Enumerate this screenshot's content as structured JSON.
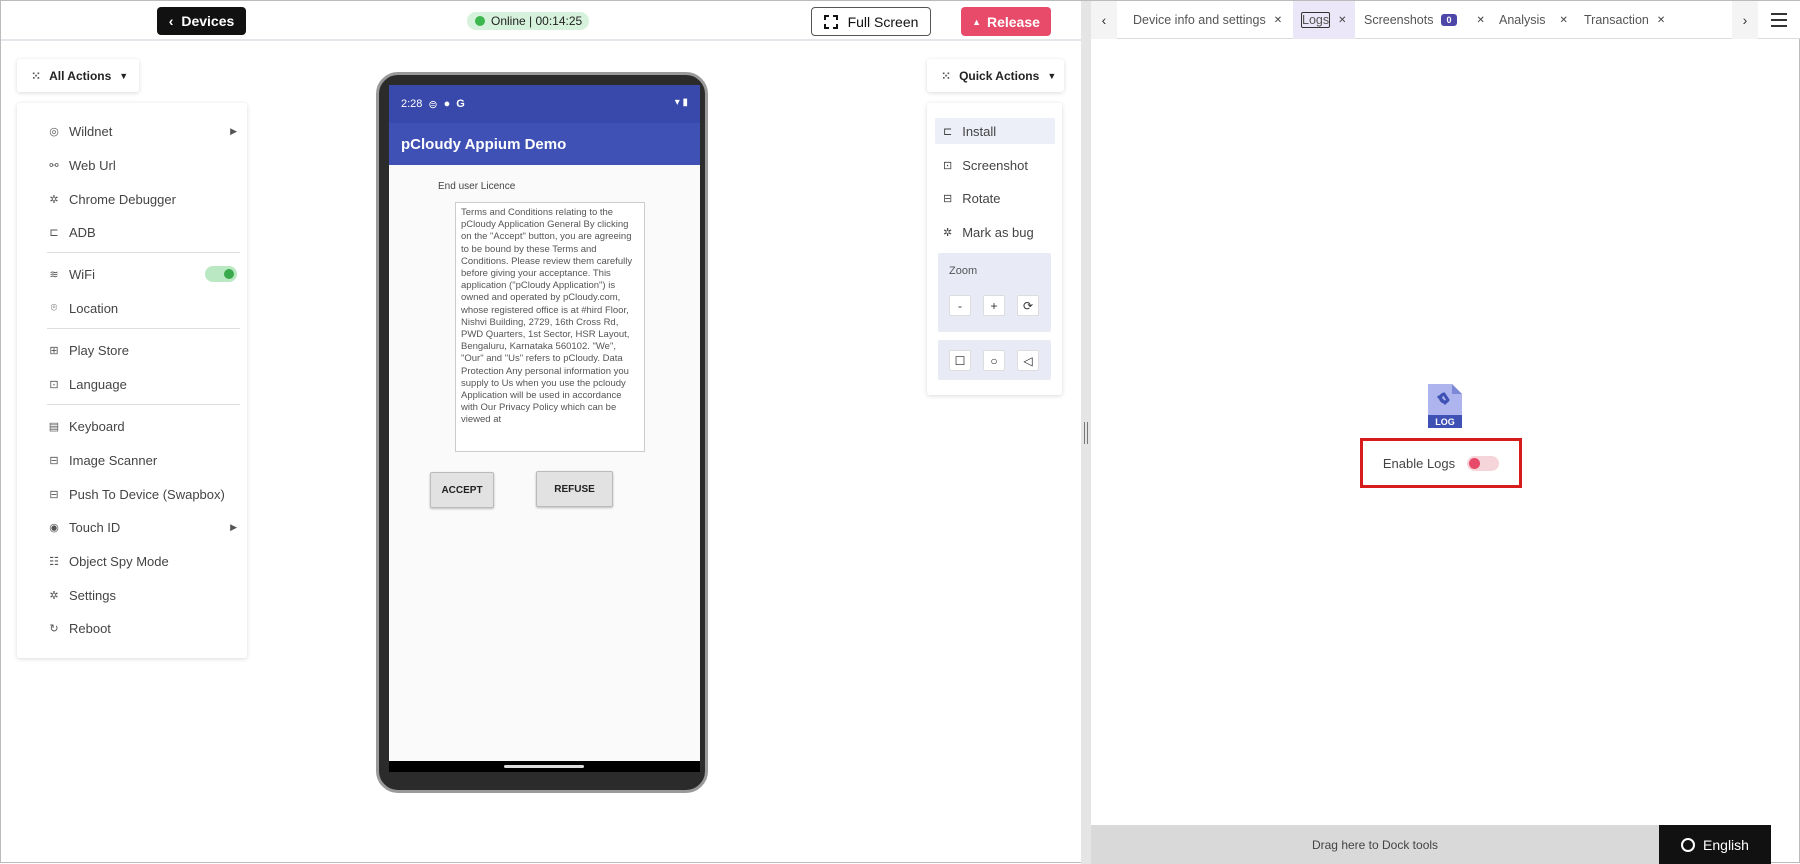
{
  "topbar": {
    "devices_label": "Devices",
    "status_text": "Online | 00:14:25",
    "fullscreen_label": "Full Screen",
    "release_label": "Release"
  },
  "left_menu": {
    "title": "All Actions",
    "items": [
      {
        "label": "Wildnet",
        "icon": "wildnet-icon",
        "has_submenu": true
      },
      {
        "label": "Web Url",
        "icon": "link-icon"
      },
      {
        "label": "Chrome Debugger",
        "icon": "bug-icon"
      },
      {
        "label": "ADB",
        "icon": "adb-icon"
      },
      {
        "label": "WiFi",
        "icon": "wifi-icon",
        "toggle": true
      },
      {
        "label": "Location",
        "icon": "location-pin-icon"
      },
      {
        "label": "Play Store",
        "icon": "apps-icon"
      },
      {
        "label": "Language",
        "icon": "language-icon"
      },
      {
        "label": "Keyboard",
        "icon": "keyboard-icon"
      },
      {
        "label": "Image Scanner",
        "icon": "image-scanner-icon"
      },
      {
        "label": "Push To Device (Swapbox)",
        "icon": "push-icon"
      },
      {
        "label": "Touch ID",
        "icon": "fingerprint-icon",
        "has_submenu": true
      },
      {
        "label": "Object Spy Mode",
        "icon": "spy-icon"
      },
      {
        "label": "Settings",
        "icon": "gear-icon"
      },
      {
        "label": "Reboot",
        "icon": "reboot-icon"
      }
    ]
  },
  "phone": {
    "time": "2:28",
    "app_title": "pCloudy Appium Demo",
    "licence_title": "End user Licence",
    "terms_text": "Terms and Conditions relating to the pCloudy Application  General By clicking on the \"Accept\" button, you are agreeing to be bound by these Terms and Conditions. Please review them carefully before giving your acceptance. This application (\"pCloudy Application\") is owned and operated by pCloudy.com, whose registered office is at #hird Floor, Nishvi Building, 2729, 16th Cross Rd, PWD Quarters, 1st Sector, HSR Layout, Bengaluru, Karnataka 560102. \"We\", \"Our\" and \"Us\" refers to pCloudy.  Data Protection Any personal information you supply to Us when you use the pcloudy Application will be used in accordance with Our Privacy Policy which can be viewed at",
    "accept_label": "ACCEPT",
    "refuse_label": "REFUSE"
  },
  "quick_actions": {
    "title": "Quick Actions",
    "items": [
      {
        "label": "Install",
        "icon": "install-icon"
      },
      {
        "label": "Screenshot",
        "icon": "screenshot-icon"
      },
      {
        "label": "Rotate",
        "icon": "rotate-icon"
      },
      {
        "label": "Mark as bug",
        "icon": "bug-icon"
      }
    ],
    "zoom_label": "Zoom",
    "zoom_out": "-",
    "zoom_in": "+"
  },
  "right_panel": {
    "tabs": [
      {
        "label": "Device info and settings"
      },
      {
        "label": "Logs",
        "active": true
      },
      {
        "label": "Screenshots",
        "badge": "0"
      },
      {
        "label": "Analysis"
      },
      {
        "label": "Transaction"
      }
    ],
    "log_icon_text": "LOG",
    "enable_logs_label": "Enable Logs",
    "enable_logs_state": false,
    "dock_text": "Drag here to Dock tools",
    "language_label": "English"
  },
  "colors": {
    "accent": "#3f51b5",
    "release": "#e84b6a",
    "online": "#3cb64f",
    "highlight_border": "#d81b1b"
  }
}
